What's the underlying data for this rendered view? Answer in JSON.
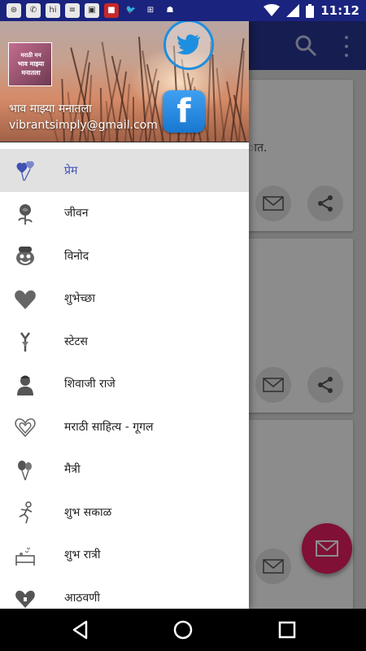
{
  "status_bar": {
    "time": "11:12",
    "notification_icons": [
      "whatsapp-icon",
      "hike-icon",
      "docs-icon",
      "gallery-icon",
      "news-icon",
      "twitter-icon",
      "bars-icon",
      "android-icon"
    ],
    "color": "#1a237e"
  },
  "app": {
    "toolbar_color": "#283593",
    "card_snippet": "ात."
  },
  "drawer": {
    "header": {
      "profile_image_text": [
        "मराठी मन",
        "भाव माझ्या",
        "मनातला"
      ],
      "name": "भाव माझ्या मनातला",
      "email": "vibrantsimply@gmail.com",
      "facebook_letter": "f"
    },
    "items": [
      {
        "label": "प्रेम",
        "icon": "balloon-heart-icon",
        "active": true
      },
      {
        "label": "जीवन",
        "icon": "rose-icon",
        "active": false
      },
      {
        "label": "विनोद",
        "icon": "clown-face-icon",
        "active": false
      },
      {
        "label": "शुभेच्छा",
        "icon": "heart-card-icon",
        "active": false
      },
      {
        "label": "स्टेटस",
        "icon": "arrow-heart-icon",
        "active": false
      },
      {
        "label": "शिवाजी राजे",
        "icon": "warrior-bust-icon",
        "active": false
      },
      {
        "label": "मराठी साहित्य - गूगल",
        "icon": "heart-swirl-icon",
        "active": false
      },
      {
        "label": "मैत्री",
        "icon": "balloons-icon",
        "active": false
      },
      {
        "label": "शुभ सकाळ",
        "icon": "runner-icon",
        "active": false
      },
      {
        "label": "शुभ रात्री",
        "icon": "bed-icon",
        "active": false
      },
      {
        "label": "आठवणी",
        "icon": "heart-lock-icon",
        "active": false
      }
    ],
    "accent": "#3f51b5"
  },
  "fab_color": "#e91e63"
}
